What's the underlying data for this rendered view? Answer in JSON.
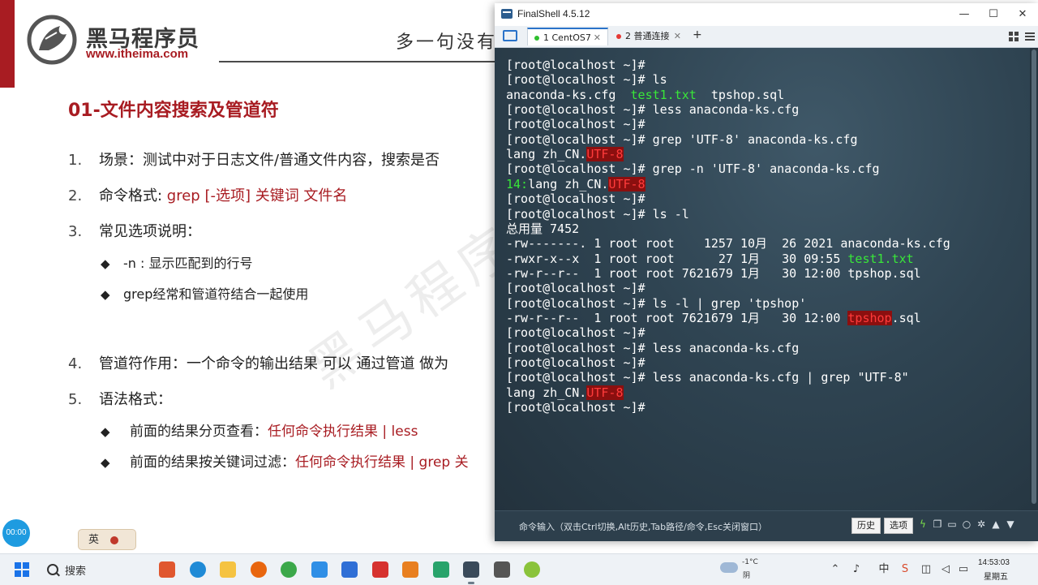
{
  "slide": {
    "brand_name": "黑马程序员",
    "brand_url": "www.itheima.com",
    "slogan": "多一句没有",
    "title": "01-文件内容搜索及管道符",
    "items": [
      {
        "num": "1.",
        "text": "场景：测试中对于日志文件/普通文件内容，搜索是否"
      },
      {
        "num": "2.",
        "label": "命令格式: ",
        "highlight": "grep [-选项] 关键词  文件名"
      },
      {
        "num": "3.",
        "text": "常见选项说明："
      },
      {
        "num": "4.",
        "text": "管道符作用：一个命令的输出结果 可以 通过管道 做为"
      },
      {
        "num": "5.",
        "text": "语法格式："
      }
    ],
    "options": [
      {
        "bullet": "◆",
        "text": "-n : 显示匹配到的行号"
      },
      {
        "bullet": "◆",
        "text": "grep经常和管道符结合一起使用"
      }
    ],
    "syntax": [
      {
        "bullet": "◆",
        "label": "前面的结果分页查看：",
        "highlight": "任何命令执行结果 | less"
      },
      {
        "bullet": "◆",
        "label": "前面的结果按关键词过滤：",
        "highlight": "任何命令执行结果 | grep 关"
      }
    ],
    "watermark": "黑马程序员",
    "recording_time": "00:00",
    "ime_label": "英"
  },
  "finalshell": {
    "title": "FinalShell 4.5.12",
    "tabs": [
      {
        "label": "1 CentOS7",
        "status_color": "#2fbf2f",
        "active": true
      },
      {
        "label": "2 普通连接",
        "status_color": "#e53935",
        "active": false
      }
    ],
    "terminal_lines": [
      {
        "segments": [
          {
            "t": "[root@localhost ~]#"
          }
        ]
      },
      {
        "segments": [
          {
            "t": "[root@localhost ~]# ls"
          }
        ]
      },
      {
        "segments": [
          {
            "t": "anaconda-ks.cfg  "
          },
          {
            "t": "test1.txt",
            "c": "green"
          },
          {
            "t": "  tpshop.sql"
          }
        ]
      },
      {
        "segments": [
          {
            "t": "[root@localhost ~]# less anaconda-ks.cfg"
          }
        ]
      },
      {
        "segments": [
          {
            "t": "[root@localhost ~]#"
          }
        ]
      },
      {
        "segments": [
          {
            "t": "[root@localhost ~]# grep 'UTF-8' anaconda-ks.cfg"
          }
        ]
      },
      {
        "segments": [
          {
            "t": "lang zh_CN."
          },
          {
            "t": "UTF-8",
            "c": "red"
          }
        ]
      },
      {
        "segments": [
          {
            "t": "[root@localhost ~]# grep -n 'UTF-8' anaconda-ks.cfg"
          }
        ]
      },
      {
        "segments": [
          {
            "t": "14:",
            "c": "green"
          },
          {
            "t": "lang zh_CN."
          },
          {
            "t": "UTF-8",
            "c": "red"
          }
        ]
      },
      {
        "segments": [
          {
            "t": "[root@localhost ~]#"
          }
        ]
      },
      {
        "segments": [
          {
            "t": "[root@localhost ~]# ls -l"
          }
        ]
      },
      {
        "segments": [
          {
            "t": "总用量 7452"
          }
        ]
      },
      {
        "segments": [
          {
            "t": "-rw-------. 1 root root    1257 10月  26 2021 anaconda-ks.cfg"
          }
        ]
      },
      {
        "segments": [
          {
            "t": "-rwxr-x--x  1 root root      27 1月   30 09:55 "
          },
          {
            "t": "test1.txt",
            "c": "green"
          }
        ]
      },
      {
        "segments": [
          {
            "t": "-rw-r--r--  1 root root 7621679 1月   30 12:00 tpshop.sql"
          }
        ]
      },
      {
        "segments": [
          {
            "t": "[root@localhost ~]#"
          }
        ]
      },
      {
        "segments": [
          {
            "t": "[root@localhost ~]# ls -l | grep 'tpshop'"
          }
        ]
      },
      {
        "segments": [
          {
            "t": "-rw-r--r--  1 root root 7621679 1月   30 12:00 "
          },
          {
            "t": "tpshop",
            "c": "red"
          },
          {
            "t": ".sql"
          }
        ]
      },
      {
        "segments": [
          {
            "t": "[root@localhost ~]#"
          }
        ]
      },
      {
        "segments": [
          {
            "t": "[root@localhost ~]# less anaconda-ks.cfg"
          }
        ]
      },
      {
        "segments": [
          {
            "t": "[root@localhost ~]#"
          }
        ]
      },
      {
        "segments": [
          {
            "t": "[root@localhost ~]# less anaconda-ks.cfg | grep \"UTF-8\""
          }
        ]
      },
      {
        "segments": [
          {
            "t": "lang zh_CN."
          },
          {
            "t": "UTF-8",
            "c": "red"
          }
        ]
      },
      {
        "segments": [
          {
            "t": "[root@localhost ~]#"
          }
        ]
      }
    ],
    "command_hint": "命令输入（双击Ctrl切换,Alt历史,Tab路径/命令,Esc关闭窗口）",
    "history_button": "历史",
    "options_button": "选项",
    "tool_icons": [
      "lightning-icon",
      "copy-icon",
      "folder-icon",
      "search-icon",
      "gear-icon",
      "upload-icon",
      "download-icon"
    ]
  },
  "taskbar": {
    "search_label": "搜索",
    "apps": [
      {
        "name": "gift-app-icon",
        "color": "#e0572f"
      },
      {
        "name": "edge-icon",
        "color": "#1f8ad6"
      },
      {
        "name": "file-explorer-icon",
        "color": "#f5c342"
      },
      {
        "name": "firefox-icon",
        "color": "#e8660f"
      },
      {
        "name": "chrome-icon",
        "color": "#3ba84a"
      },
      {
        "name": "snipping-tool-icon",
        "color": "#2f8fe6"
      },
      {
        "name": "feedback-icon",
        "color": "#2f6fd6"
      },
      {
        "name": "pdf-icon",
        "color": "#d6322f"
      },
      {
        "name": "wps-icon",
        "color": "#e87f1f"
      },
      {
        "name": "spreadsheet-app-icon",
        "color": "#28a36b"
      },
      {
        "name": "finalshell-taskbar-icon",
        "color": "#3a4a5a"
      },
      {
        "name": "clock-app-icon",
        "color": "#555555"
      },
      {
        "name": "bubble-app-icon",
        "color": "#8ac33b"
      }
    ],
    "weather_temp": "-1°C",
    "weather_desc": "阴",
    "time": "14:53:03",
    "day": "星期五"
  }
}
